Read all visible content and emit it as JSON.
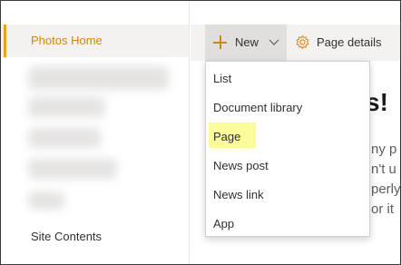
{
  "nav": {
    "home_label": "Photos Home",
    "site_contents_label": "Site Contents",
    "accent_color": "#e8a317"
  },
  "command_bar": {
    "new_label": "New",
    "page_details_label": "Page details"
  },
  "new_menu": {
    "items": [
      {
        "label": "List"
      },
      {
        "label": "Document library"
      },
      {
        "label": "Page",
        "highlighted": true
      },
      {
        "label": "News post"
      },
      {
        "label": "News link"
      },
      {
        "label": "App"
      }
    ],
    "highlight_color": "#fbfb9a"
  },
  "page_content": {
    "heading_fragment": "s!",
    "text_fragments": [
      "ny p",
      "n't u",
      "perly",
      "or it"
    ]
  }
}
